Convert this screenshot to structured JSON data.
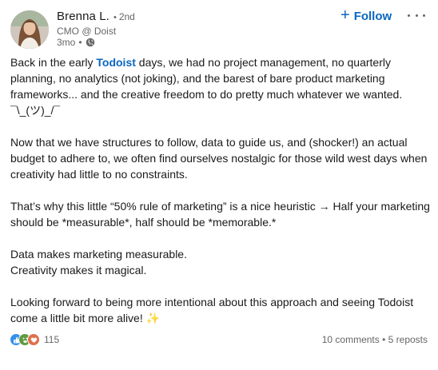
{
  "author": {
    "name": "Brenna L.",
    "degree": "2nd",
    "degree_sep": "•",
    "headline": "CMO @ Doist",
    "time": "3mo",
    "time_sep": "•",
    "visibility_icon": "globe-icon"
  },
  "follow": {
    "label": "Follow",
    "icon": "+"
  },
  "more_icon": "ellipsis-icon",
  "post": {
    "p1_before": "Back in the early ",
    "p1_brand": "Todoist",
    "p1_after": " days, we had no project management, no quarterly planning, no analytics (not joking), and the barest of bare product marketing frameworks... and the creative freedom to do pretty much whatever we wanted. ¯\\_(ツ)_/¯",
    "p2": "Now that we have structures to follow, data to guide us, and (shocker!) an actual budget to adhere to, we often find ourselves nostalgic for those wild west days when creativity had little to no constraints.",
    "p3": "That’s why this little “50% rule of marketing” is a nice heuristic → Half your marketing should be *measurable*, half should be *memorable.*",
    "p4_line1": "Data makes marketing measurable.",
    "p4_line2": "Creativity makes it magical.",
    "p5": "Looking forward to being more intentional about this approach and seeing Todoist come a little bit more alive! ✨"
  },
  "social": {
    "reaction_icons": [
      "like-icon",
      "celebrate-icon",
      "love-icon"
    ],
    "reaction_count": "115",
    "comments": "10 comments",
    "sep": "•",
    "reposts": "5 reposts"
  },
  "colors": {
    "brand_blue": "#0a66c2",
    "like": "#378fe9",
    "celebrate": "#5f9b41",
    "love": "#df704d"
  }
}
